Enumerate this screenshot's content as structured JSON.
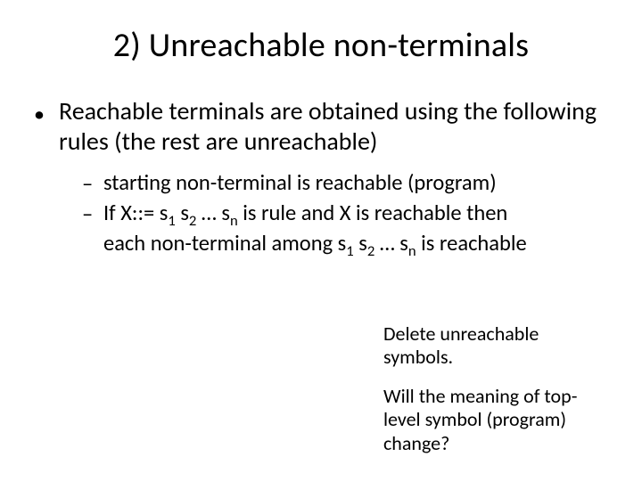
{
  "title": "2) Unreachable non-terminals",
  "bullet": "Reachable terminals are obtained using the following rules (the rest are unreachable)",
  "sub1": "starting non-terminal is reachable (program)",
  "s2_a": "If X::= s",
  "s2_b": " s",
  "s2_c": " … s",
  "s2_d": " is rule and  X is reachable then",
  "s2_e": "each non-terminal among s",
  "s2_f": " s",
  "s2_g": " … s",
  "s2_h": " is reachable",
  "idx1": "1",
  "idx2": "2",
  "idxn": "n",
  "note1": "Delete unreachable symbols.",
  "note2": "Will the meaning of top-level symbol (program) change?"
}
